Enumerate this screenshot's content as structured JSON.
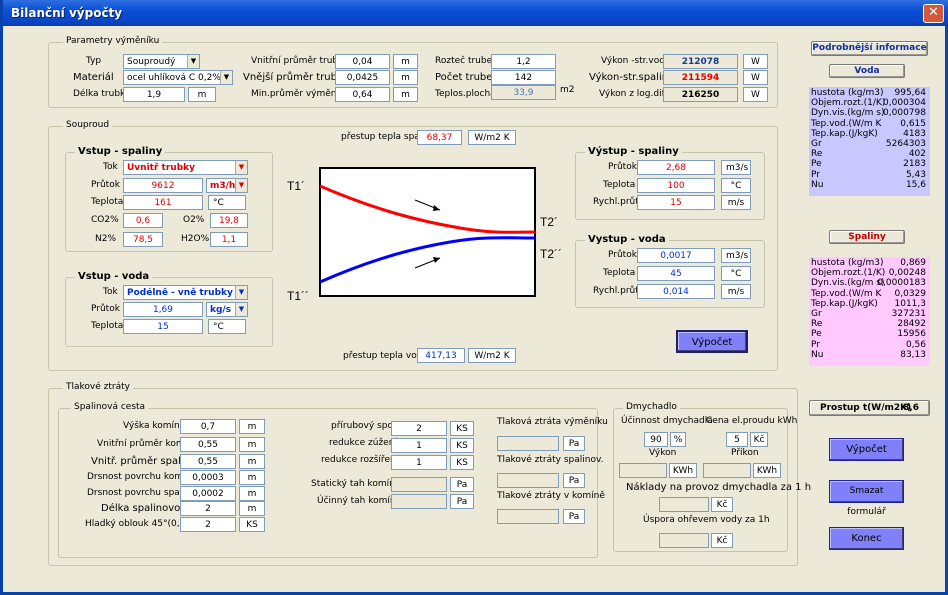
{
  "window": {
    "title": "Bilanční výpočty",
    "close": "✕"
  },
  "params": {
    "title": "Parametry výměníku",
    "typ_label": "Typ",
    "typ_value": "Souproudý",
    "material_label": "Materiál",
    "material_value": "ocel uhlíková C 0,2%",
    "delka_label": "Délka trubky",
    "delka_value": "1,9",
    "delka_unit": "m",
    "vnitrni_label": "Vnitřní průměr trubky",
    "vnitrni_value": "0,04",
    "vnitrni_unit": "m",
    "vnejsi_label": "Vnější průměr trubky",
    "vnejsi_value": "0,0425",
    "vnejsi_unit": "m",
    "min_label": "Min.průměr výměníku",
    "min_value": "0,64",
    "min_unit": "m",
    "roztec_label": "Rozteč trubek",
    "roztec_value": "1,2",
    "pocet_label": "Počet trubek",
    "pocet_value": "142",
    "plocha_label": "Teplos.plocha",
    "plocha_value": "33,9",
    "plocha_unit": "m2",
    "vykon_voda_label": "Výkon -str.voda",
    "vykon_voda_value": "212078",
    "vykon_voda_unit": "W",
    "vykon_spal_label": "Výkon-str.spaliny",
    "vykon_spal_value": "211594",
    "vykon_spal_unit": "W",
    "vykon_log_label": "Výkon z log.difer",
    "vykon_log_value": "216250",
    "vykon_log_unit": "W"
  },
  "souproud": {
    "title": "Souproud",
    "prestup_spalin_label": "přestup tepla spalin",
    "prestup_spalin_value": "68,37",
    "prestup_spalin_unit": "W/m2 K",
    "prestup_voda_label": "přestup  tepla voda",
    "prestup_voda_value": "417,13",
    "prestup_voda_unit": "W/m2 K",
    "vstup_spaliny": {
      "title": "Vstup - spaliny",
      "tok_label": "Tok",
      "tok_value": "Uvnitř trubky",
      "prutok_label": "Průtok",
      "prutok_value": "9612",
      "prutok_unit": "m3/h",
      "teplota_label": "Teplota",
      "teplota_value": "161",
      "teplota_unit": "°C",
      "co2_label": "CO2%",
      "co2_value": "0,6",
      "o2_label": "O2%",
      "o2_value": "19,8",
      "n2_label": "N2%",
      "n2_value": "78,5",
      "h2o_label": "H2O%",
      "h2o_value": "1,1"
    },
    "vstup_voda": {
      "title": "Vstup - voda",
      "tok_label": "Tok",
      "tok_value": "Podélně - vně trubky",
      "prutok_label": "Průtok",
      "prutok_value": "1,69",
      "prutok_unit": "kg/s",
      "teplota_label": "Teplota",
      "teplota_value": "15",
      "teplota_unit": "°C"
    },
    "vystup_spaliny": {
      "title": "Výstup - spaliny",
      "prutok_label": "Průtok",
      "prutok_value": "2,68",
      "prutok_unit": "m3/s",
      "teplota_label": "Teplota",
      "teplota_value": "100",
      "teplota_unit": "°C",
      "rychl_label": "Rychl.průt",
      "rychl_value": "15",
      "rychl_unit": "m/s"
    },
    "vystup_voda": {
      "title": "Vystup - voda",
      "prutok_label": "Průtok",
      "prutok_value": "0,0017",
      "prutok_unit": "m3/s",
      "teplota_label": "Teplota",
      "teplota_value": "45",
      "teplota_unit": "°C",
      "rychl_label": "Rychl.průt",
      "rychl_value": "0,014",
      "rychl_unit": "m/s"
    },
    "diagram": {
      "t1": "T1´",
      "t1b": "T1´´",
      "t2": "T2´",
      "t2b": "T2´´",
      "hot_color": "#ff0000",
      "cold_color": "#0000ff"
    },
    "vypocet_label": "Výpočet"
  },
  "tlak": {
    "title": "Tlakové ztráty",
    "spal_title": "Spalinová cesta",
    "vyska_label": "Výška komínu",
    "vyska_value": "0,7",
    "vyska_unit": "m",
    "vnitrni_kom_label": "Vnitřní průměr komínu",
    "vnitrni_kom_value": "0,55",
    "vnitrni_kom_unit": "m",
    "vnitr_spal_label": "Vnitř. průměr spalin.",
    "vnitr_spal_value": "0,55",
    "vnitr_spal_unit": "m",
    "drsnost_kom_label": "Drsnost povrchu komína",
    "drsnost_kom_value": "0,0003",
    "drsnost_kom_unit": "m",
    "drsnost_spal_label": "Drsnost povrchu spalin.",
    "drsnost_spal_value": "0,0002",
    "drsnost_spal_unit": "m",
    "delka_label": "Délka spalinovodu",
    "delka_value": "2",
    "delka_unit": "m",
    "oblouk_label": "Hladký oblouk 45°(0,5m)",
    "oblouk_value": "2",
    "oblouk_unit": "KS",
    "prirub_label": "přírubový spoj",
    "prirub_value": "2",
    "prirub_unit": "KS",
    "zuzeni_label": "redukce zúžení",
    "zuzeni_value": "1",
    "zuzeni_unit": "KS",
    "rozsireni_label": "redukce rozšíření",
    "rozsireni_value": "1",
    "rozsireni_unit": "KS",
    "staticky_label": "Statický tah komínu",
    "staticky_unit": "Pa",
    "ucinny_label": "Účinný tah komínu",
    "ucinny_unit": "Pa",
    "ztr_vym_label": "Tlaková ztráta výměníku",
    "ztr_vym_unit": "Pa",
    "ztr_spal_label": "Tlakové ztráty  spalinov.",
    "ztr_spal_unit": "Pa",
    "ztr_kom_label": "Tlakové ztráty v komíně",
    "ztr_kom_unit": "Pa"
  },
  "dmychadlo": {
    "title": "Dmychadlo",
    "ucinnost_label": "Účinnost dmychadla",
    "ucinnost_value": "90",
    "ucinnost_unit": "%",
    "cena_label": "Cena el.proudu kWh",
    "cena_value": "5",
    "cena_unit": "Kč",
    "vykon_label": "Výkon",
    "vykon_unit": "KWh",
    "prikon_label": "Příkon",
    "prikon_unit": "KWh",
    "naklady_label": "Náklady na provoz dmychadla za 1 h",
    "naklady_unit": "Kč",
    "uspora_label": "Úspora  ohřevem vody za 1h",
    "uspora_unit": "Kč"
  },
  "side": {
    "title": "Podrobnější informace",
    "voda_btn": "Voda",
    "spaliny_btn": "Spaliny",
    "voda_props": [
      {
        "k": "hustota (kg/m3)",
        "v": "995,64"
      },
      {
        "k": "Objem.rozt.(1/K)",
        "v": "0,000304"
      },
      {
        "k": "Dyn.vis.(kg/m s)",
        "v": "0,000798"
      },
      {
        "k": "Tep.vod.(W/m K",
        "v": "0,615"
      },
      {
        "k": "Tep.kap.(J/kgK)",
        "v": "4183"
      },
      {
        "k": "Gr",
        "v": "5264303"
      },
      {
        "k": "Re",
        "v": "402"
      },
      {
        "k": "Pe",
        "v": "2183"
      },
      {
        "k": "Pr",
        "v": "5,43"
      },
      {
        "k": "Nu",
        "v": "15,6"
      }
    ],
    "spaliny_props": [
      {
        "k": "hustota (kg/m3)",
        "v": "0,869"
      },
      {
        "k": "Objem.rozt.(1/K)",
        "v": "0,00248"
      },
      {
        "k": "Dyn.vis.(kg/m s)",
        "v": "0,0000183"
      },
      {
        "k": "Tep.vod.(W/m K",
        "v": "0,0329"
      },
      {
        "k": "Tep.kap.(J/kgK)",
        "v": "1011,3"
      },
      {
        "k": "Gr",
        "v": "327231"
      },
      {
        "k": "Re",
        "v": "28492"
      },
      {
        "k": "Pe",
        "v": "15956"
      },
      {
        "k": "Pr",
        "v": "0,56"
      },
      {
        "k": "Nu",
        "v": "83,13"
      }
    ],
    "prostup_label": "Prostup t(W/m2K)",
    "prostup_value": "8,6",
    "vypocet_btn": "Výpočet",
    "smazat_btn": "Smazat formulář",
    "konec_btn": "Konec",
    "voda_color": "#c8c8ff",
    "spaliny_color": "#ffc8ff"
  }
}
